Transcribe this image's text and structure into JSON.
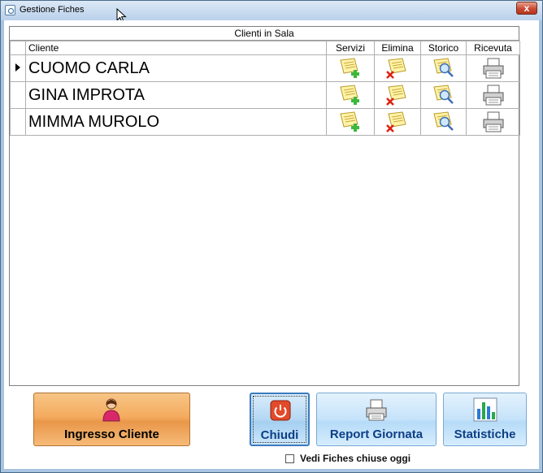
{
  "window": {
    "title": "Gestione Fiches",
    "icon": "app-icon",
    "close_label": "x"
  },
  "grid": {
    "caption": "Clienti in Sala",
    "columns": [
      "Cliente",
      "Servizi",
      "Elimina",
      "Storico",
      "Ricevuta"
    ],
    "rows": [
      {
        "name": "CUOMO CARLA",
        "selected": true
      },
      {
        "name": "GINA IMPROTA",
        "selected": false
      },
      {
        "name": "MIMMA MUROLO",
        "selected": false
      }
    ],
    "icons": {
      "servizi": "note-add-icon",
      "elimina": "note-delete-icon",
      "storico": "note-search-icon",
      "ricevuta": "printer-icon"
    }
  },
  "buttons": {
    "ingresso": "Ingresso Cliente",
    "chiudi": "Chiudi",
    "report": "Report Giornata",
    "statistiche": "Statistiche"
  },
  "checkbox": {
    "label": "Vedi Fiches chiuse oggi",
    "checked": false
  },
  "colors": {
    "accent_text": "#0d3f86",
    "ingresso_bg": "#f4ab5e",
    "chiudi_border": "#3b7bbf",
    "close_red": "#c94a34"
  }
}
